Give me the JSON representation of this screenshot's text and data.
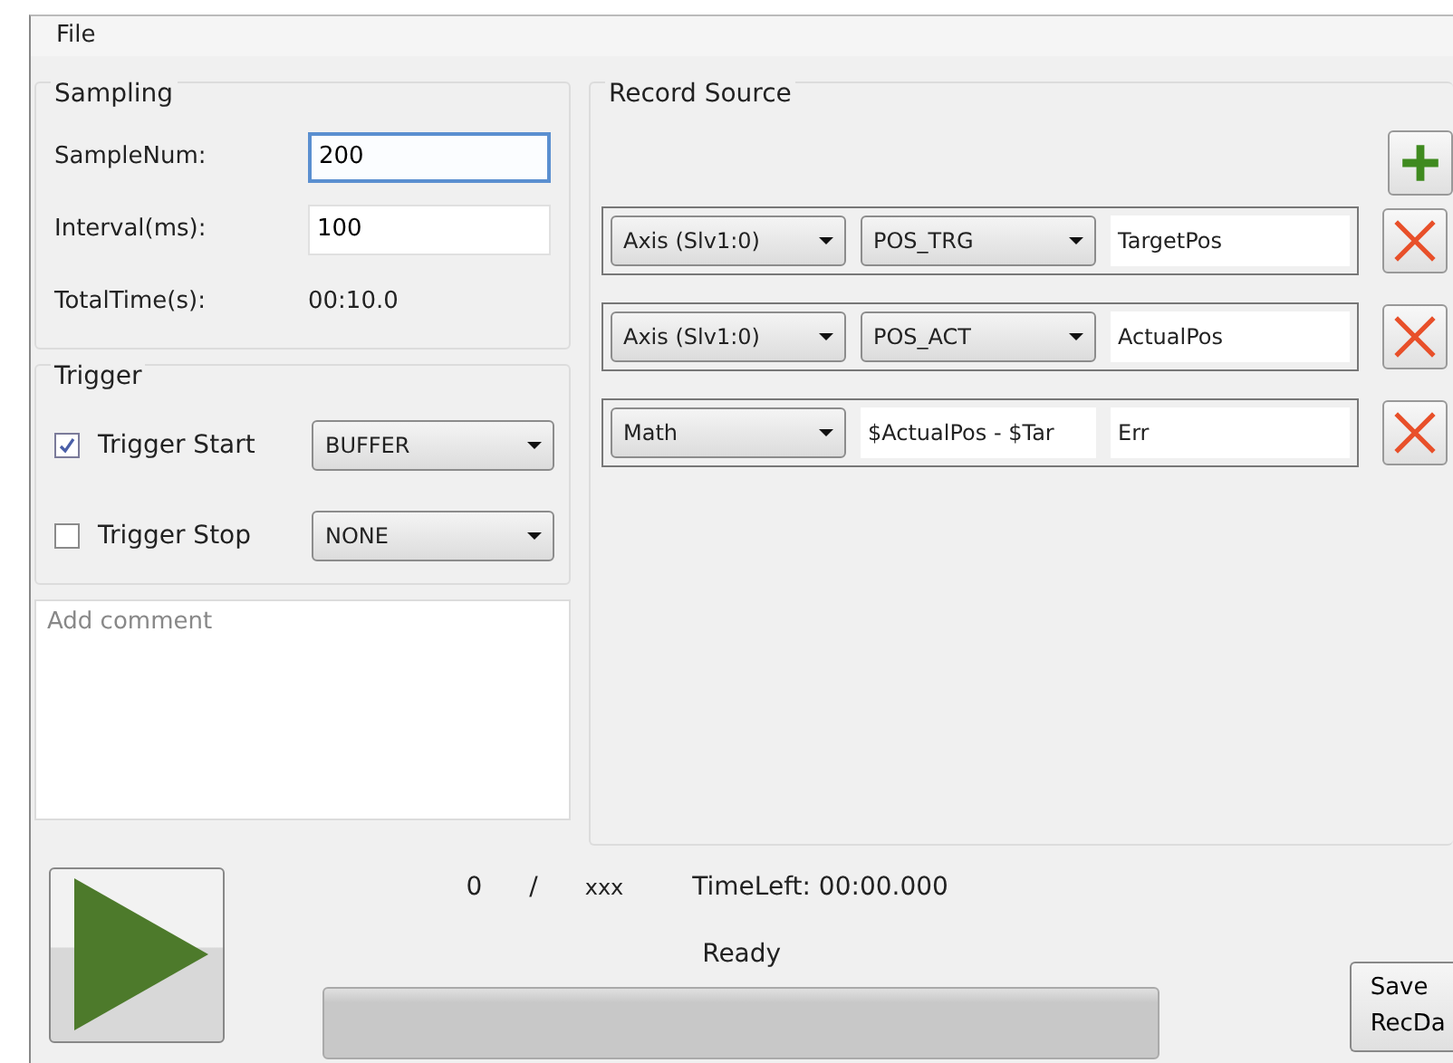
{
  "menu": [
    "File"
  ],
  "sampling": {
    "title": "Sampling",
    "fields": [
      {
        "label": "SampleNum:",
        "kind": "input",
        "value": "200",
        "focused": true
      },
      {
        "label": "Interval(ms):",
        "kind": "input",
        "value": "100",
        "focused": false
      },
      {
        "label": "TotalTime(s):",
        "kind": "text",
        "value": "00:10.0"
      }
    ]
  },
  "trigger": {
    "title": "Trigger",
    "items": [
      {
        "label": "Trigger Start",
        "checked": true,
        "option": "BUFFER"
      },
      {
        "label": "Trigger Stop",
        "checked": false,
        "option": "NONE"
      }
    ]
  },
  "comment": {
    "placeholder": "Add comment"
  },
  "record_source": {
    "title": "Record Source",
    "rows": [
      {
        "source": "Axis (Slv1:0)",
        "kind": "select",
        "signal": "POS_TRG",
        "name": "TargetPos"
      },
      {
        "source": "Axis (Slv1:0)",
        "kind": "select",
        "signal": "POS_ACT",
        "name": "ActualPos"
      },
      {
        "source": "Math",
        "kind": "input",
        "signal": "$ActualPos - $Tar",
        "name": "Err"
      }
    ]
  },
  "status": {
    "count": "0",
    "separator": "/",
    "total": "xxx",
    "time_left": "TimeLeft: 00:00.000",
    "message": "Ready",
    "progress": {
      "level": 0
    }
  },
  "save_button": "Save RecDa"
}
